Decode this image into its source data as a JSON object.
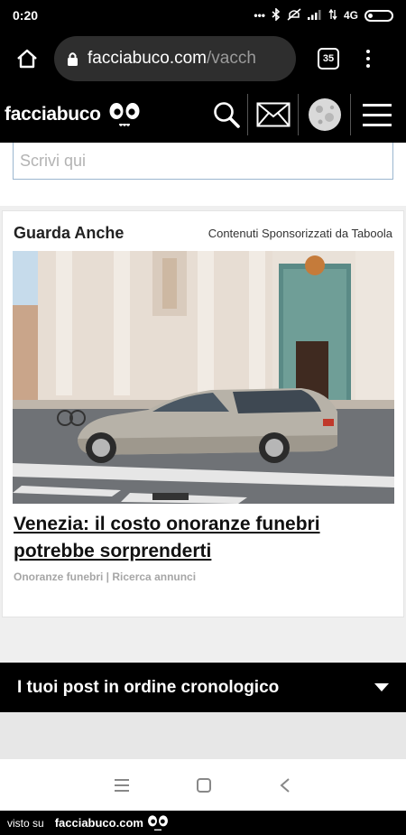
{
  "status_bar": {
    "time": "0:20",
    "network": "4G",
    "icons": [
      "dots-icon",
      "bluetooth-icon",
      "mute-icon",
      "signal-icon",
      "data-arrows-icon",
      "battery-icon"
    ]
  },
  "browser": {
    "url_host": "facciabuco.com",
    "url_path": "/vacch",
    "tab_count": "35",
    "icons": [
      "home-icon",
      "lock-icon",
      "more-vert-icon"
    ]
  },
  "site": {
    "logo_text": "facciabuco",
    "icons": [
      "eyes-logo-icon",
      "search-icon",
      "mail-icon",
      "avatar-icon",
      "hamburger-icon"
    ]
  },
  "comment": {
    "placeholder": "Scrivi qui"
  },
  "card": {
    "title": "Guarda Anche",
    "sponsor": "Contenuti Sponsorizzati da Taboola",
    "headline": "Venezia: il costo onoranze funebri potrebbe sorprenderti",
    "meta": "Onoranze funebri | Ricerca annunci"
  },
  "feed": {
    "label": "I tuoi post in ordine cronologico",
    "icons": [
      "caret-down-icon"
    ]
  },
  "android_nav": {
    "icons": [
      "recents-icon",
      "home-square-icon",
      "back-icon"
    ]
  },
  "footer": {
    "prefix": "visto su",
    "brand": "facciabuco.com"
  },
  "colors": {
    "header_bg": "#000000",
    "input_border": "#9bb6cf",
    "page_bg": "#efefef",
    "meta_text": "#a6a6a6"
  }
}
